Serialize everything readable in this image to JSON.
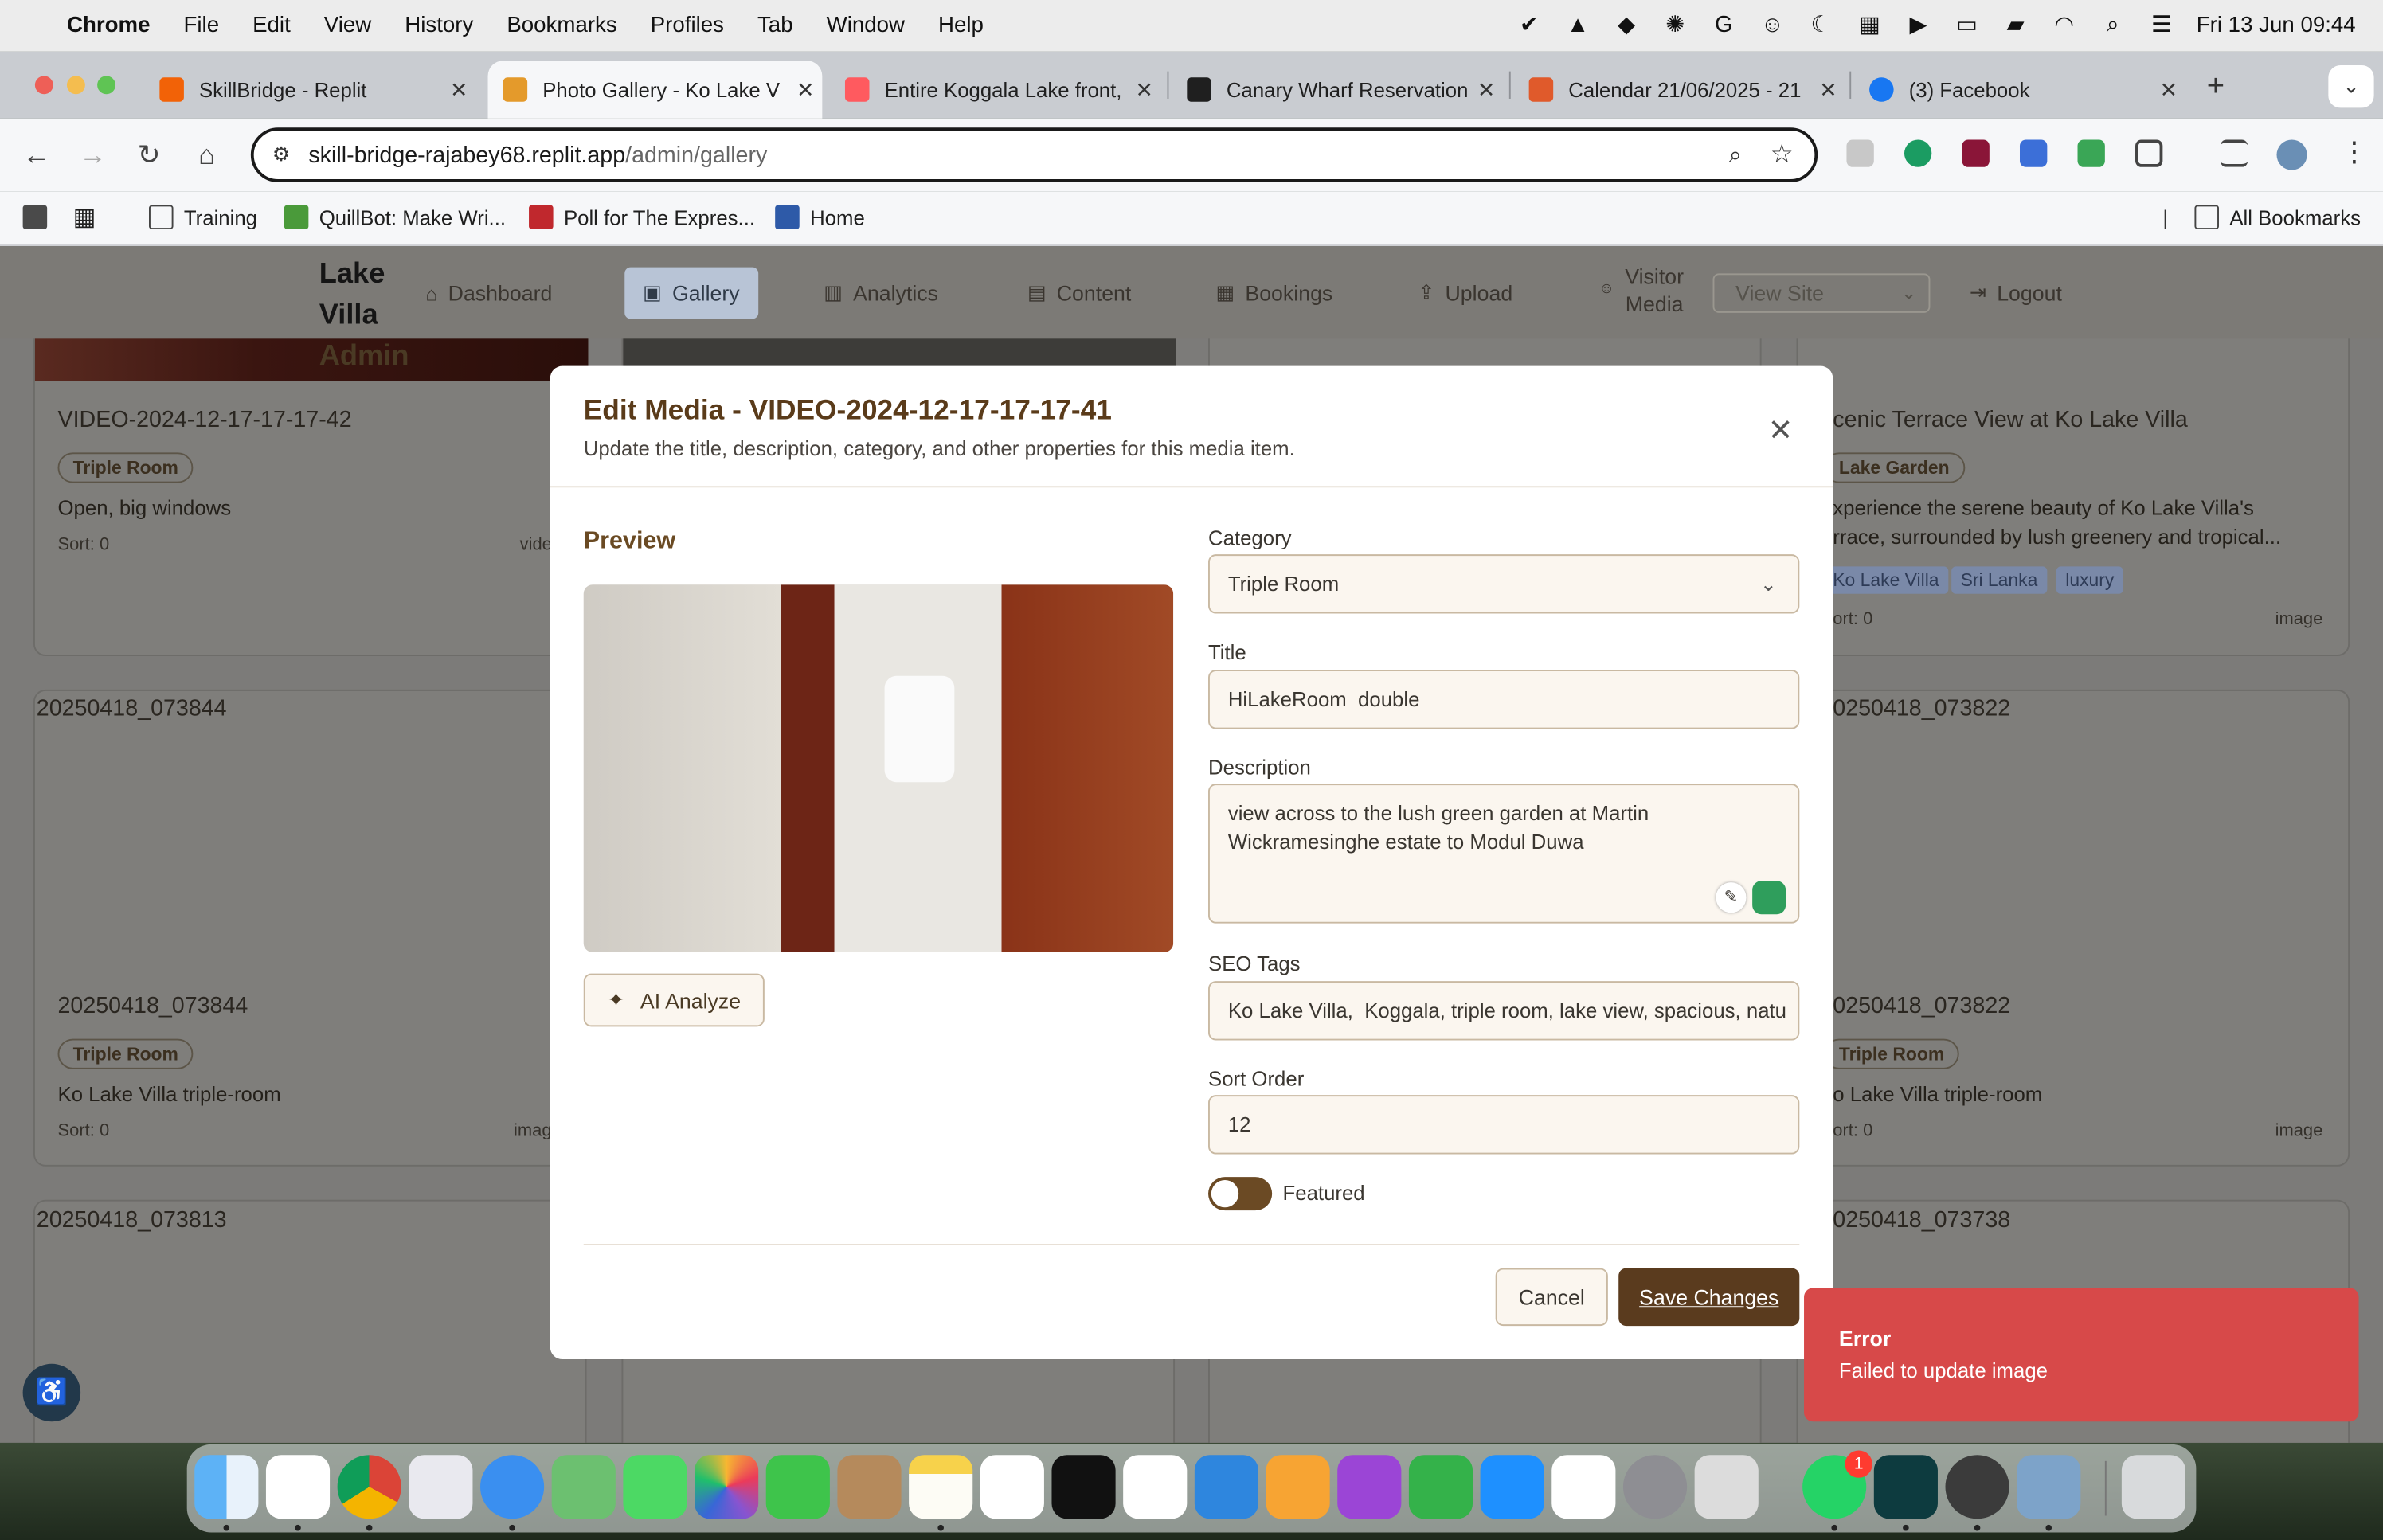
{
  "menubar": {
    "app": "Chrome",
    "items": [
      "File",
      "Edit",
      "View",
      "History",
      "Bookmarks",
      "Profiles",
      "Tab",
      "Window",
      "Help"
    ],
    "datetime": "Fri 13 Jun  09:44"
  },
  "tabs": [
    {
      "title": "SkillBridge - Replit",
      "favicon_color": "#f26207"
    },
    {
      "title": "Photo Gallery - Ko Lake V",
      "favicon_color": "#e49a2b",
      "active": true
    },
    {
      "title": "Entire Koggala Lake front,",
      "favicon_color": "#ff5a5f"
    },
    {
      "title": "Canary Wharf Reservation",
      "favicon_color": "#1f1f1f"
    },
    {
      "title": "Calendar 21/06/2025 - 21",
      "favicon_color": "#e05a2b"
    },
    {
      "title": "(3) Facebook",
      "favicon_color": "#1877f2"
    }
  ],
  "omnibox": {
    "host": "skill-bridge-rajabey68.replit.app",
    "path": "/admin/gallery"
  },
  "bookmarks": {
    "items": [
      "Training",
      "QuillBot: Make Wri...",
      "Poll for The Expres...",
      "Home"
    ],
    "all": "All Bookmarks"
  },
  "appnav": {
    "brand_line1": "Lake",
    "brand_line2": "Villa",
    "brand_line3": "Admin",
    "items": [
      "Dashboard",
      "Gallery",
      "Analytics",
      "Content",
      "Bookings",
      "Upload"
    ],
    "visitor_line1": "Visitor",
    "visitor_line2": "Media",
    "view_site": "View Site",
    "logout": "Logout"
  },
  "cards": {
    "c1": {
      "title": "VIDEO-2024-12-17-17-17-42",
      "category": "Triple Room",
      "desc": "Open, big windows",
      "sort": "Sort: 0",
      "type": "vide"
    },
    "c2": {
      "title": "cenic Terrace View at Ko Lake Villa",
      "category": "Lake Garden",
      "desc1": "xperience the serene beauty of Ko Lake Villa's",
      "desc2": "rrace, surrounded by lush greenery and tropical...",
      "tags": [
        "Ko Lake Villa",
        "Sri Lanka",
        "luxury"
      ],
      "sort": "ort: 0",
      "type": "image"
    },
    "c3": {
      "alt": "20250418_073844",
      "title": "20250418_073844",
      "category": "Triple Room",
      "desc": "Ko Lake Villa triple-room",
      "sort": "Sort: 0",
      "type": "imag"
    },
    "c4": {
      "alt": "0250418_073822",
      "title": "0250418_073822",
      "category": "Triple Room",
      "desc": "o Lake Villa triple-room",
      "sort": "ort: 0",
      "type": "image"
    },
    "c5": {
      "alt": "20250418_073813"
    },
    "c6": {
      "alt": "0250418_073738"
    }
  },
  "modal": {
    "title": "Edit Media - VIDEO-2024-12-17-17-17-41",
    "subtitle": "Update the title, description, category, and other properties for this media item.",
    "preview_label": "Preview",
    "ai_analyze": "AI Analyze",
    "category_label": "Category",
    "category_value": "Triple Room",
    "title_label": "Title",
    "title_value": "HiLakeRoom  double",
    "description_label": "Description",
    "description_value": "view across to the lush green garden at Martin Wickramesinghe estate to Modul Duwa",
    "seo_label": "SEO Tags",
    "seo_value": "Ko Lake Villa,  Koggala, triple room, lake view, spacious, natu",
    "sort_label": "Sort Order",
    "sort_value": "12",
    "featured_label": "Featured",
    "featured_on": false,
    "cancel": "Cancel",
    "save": "Save Changes"
  },
  "toast": {
    "title": "Error",
    "message": "Failed to update image"
  },
  "dock": {
    "badge": "1"
  }
}
